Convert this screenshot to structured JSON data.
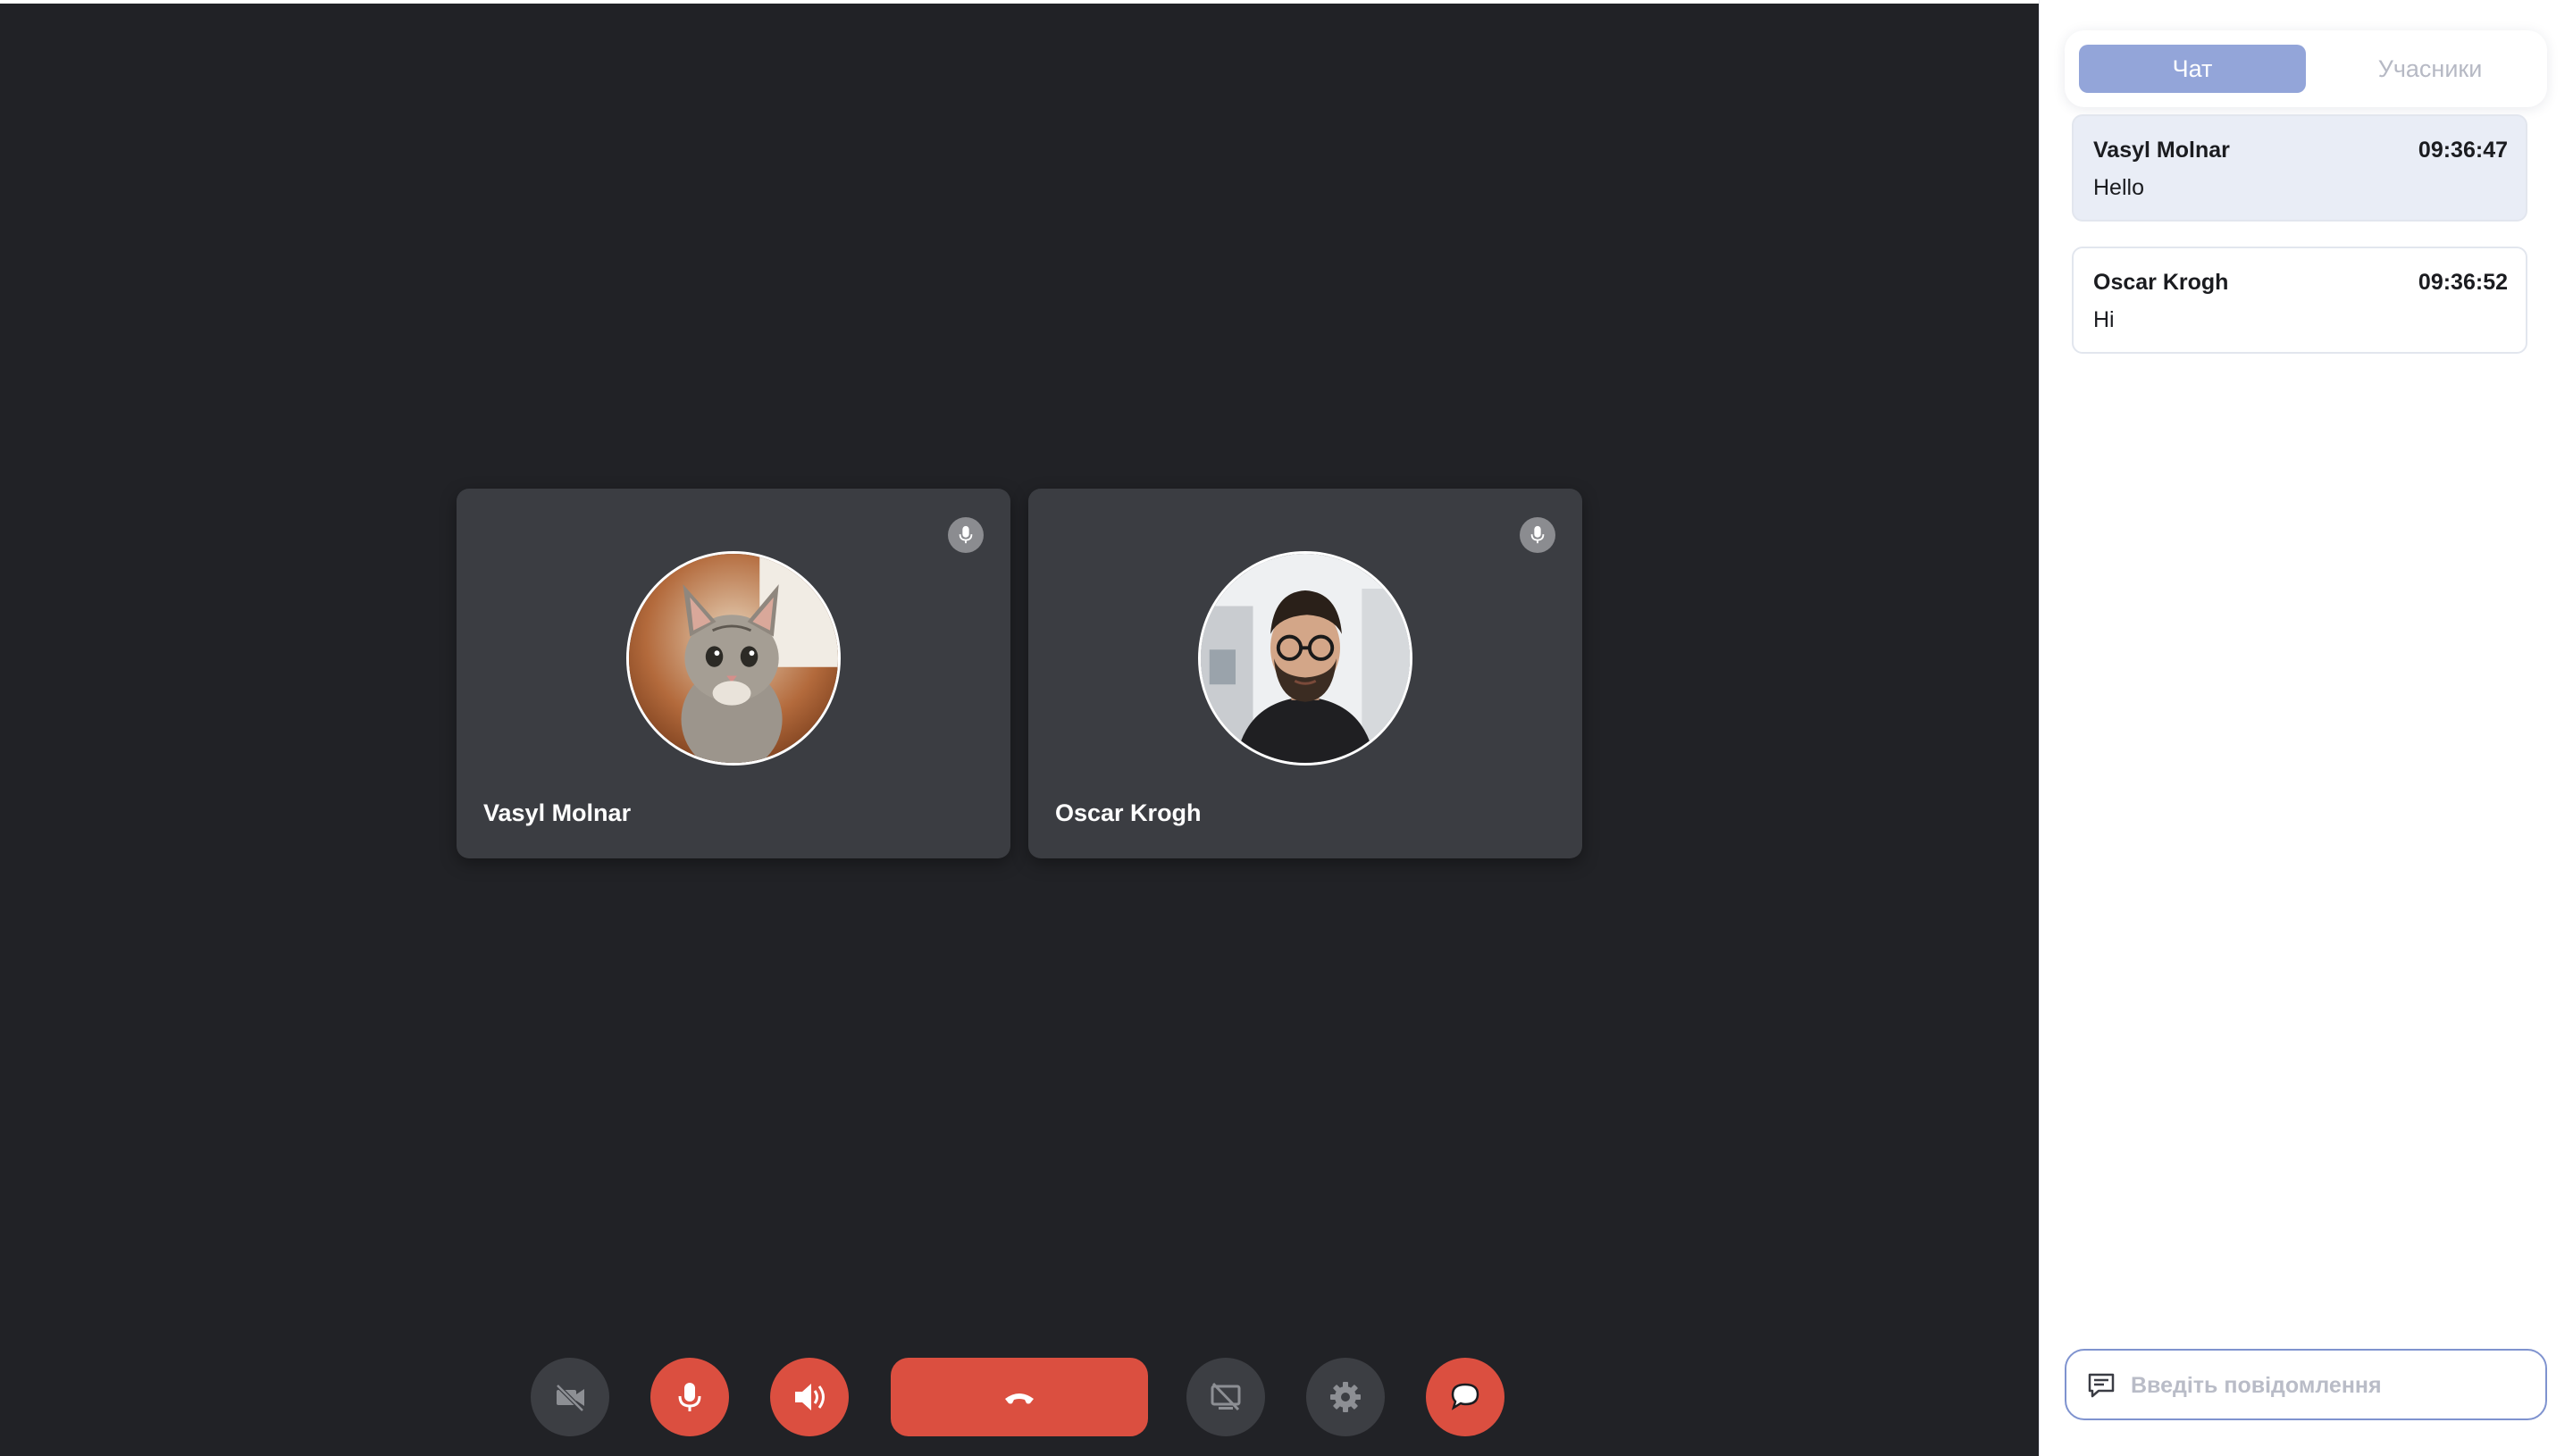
{
  "participants": [
    {
      "name": "Vasyl Molnar",
      "avatar_icon": "cat-photo-avatar",
      "mic_icon": "microphone-icon"
    },
    {
      "name": "Oscar Krogh",
      "avatar_icon": "man-photo-avatar",
      "mic_icon": "microphone-icon"
    }
  ],
  "controls": {
    "camera_icon": "video-off-icon",
    "mic_icon": "microphone-icon",
    "speaker_icon": "speaker-icon",
    "hangup_icon": "phone-hangup-icon",
    "screen_share_icon": "screen-share-off-icon",
    "settings_icon": "gear-icon",
    "chat_icon": "chat-bubble-icon"
  },
  "sidebar": {
    "tabs": [
      {
        "label": "Чат",
        "active": true
      },
      {
        "label": "Учасники",
        "active": false
      }
    ],
    "messages": [
      {
        "author": "Vasyl Molnar",
        "time": "09:36:47",
        "text": "Hello"
      },
      {
        "author": "Oscar Krogh",
        "time": "09:36:52",
        "text": "Hi"
      }
    ],
    "composer": {
      "placeholder": "Введіть повідомлення",
      "value": ""
    }
  },
  "colors": {
    "stage_bg": "#212226",
    "tile_bg": "#3b3d42",
    "accent_red": "#db4f40",
    "tab_active": "#93a5d9",
    "composer_border": "#7f93cf"
  }
}
